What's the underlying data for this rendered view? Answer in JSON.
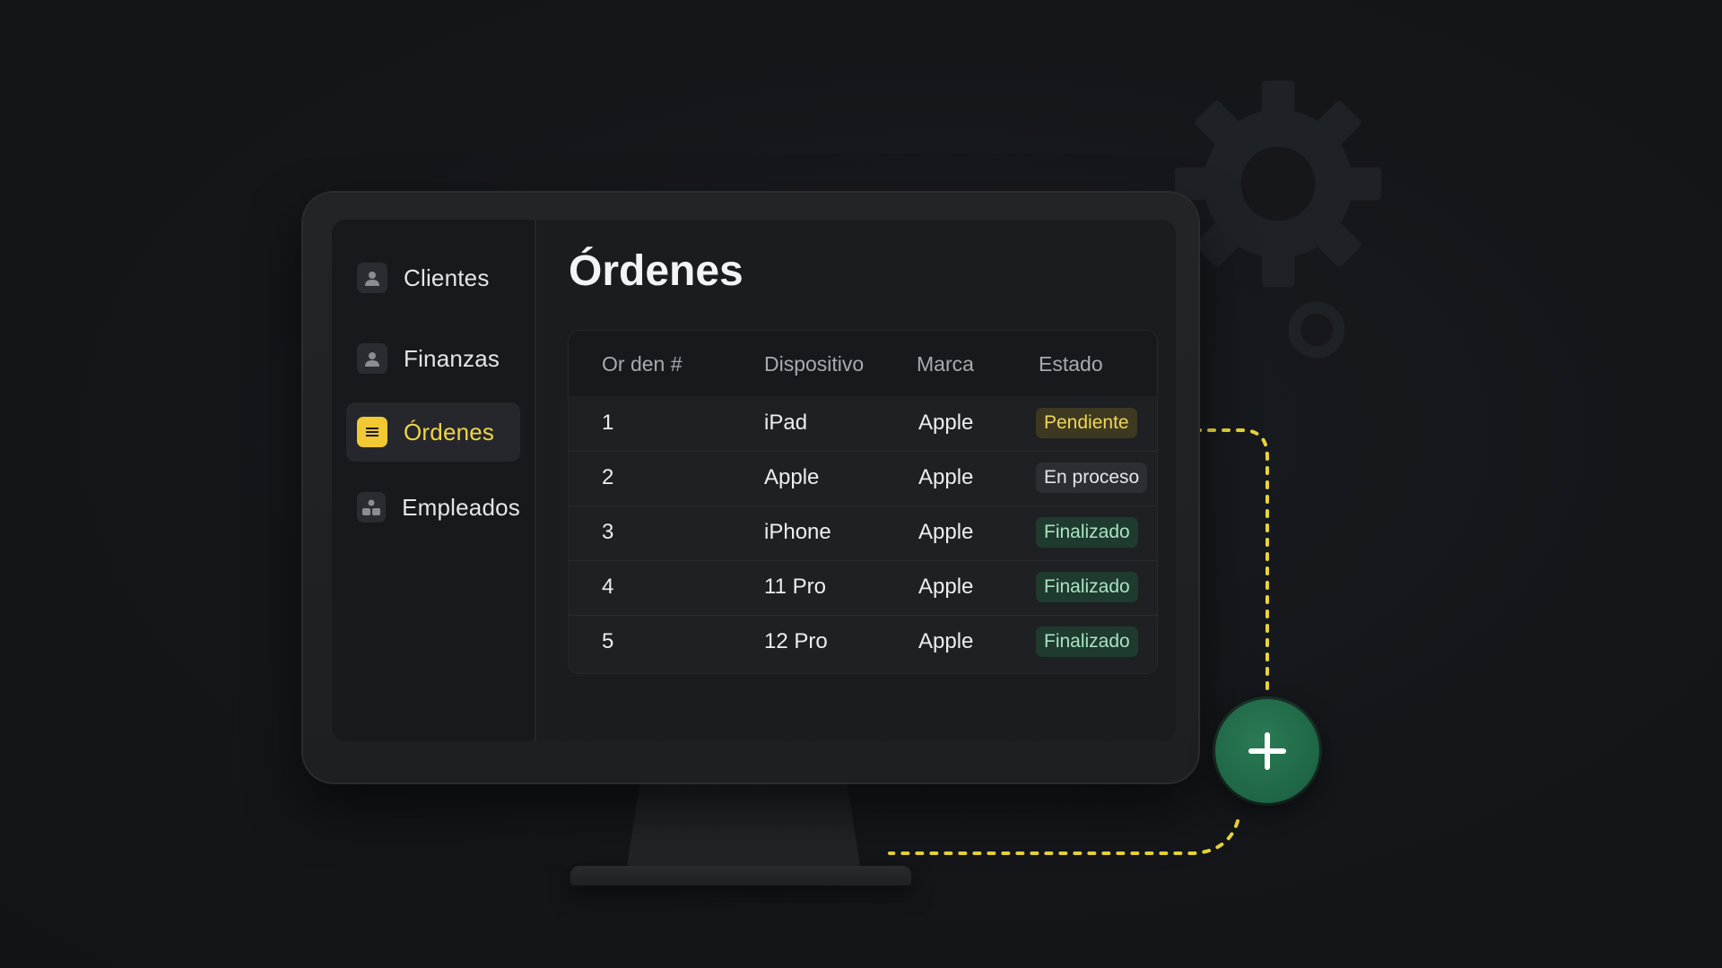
{
  "sidebar": {
    "items": [
      {
        "label": "Clientes",
        "icon": "user-icon"
      },
      {
        "label": "Finanzas",
        "icon": "user-icon"
      },
      {
        "label": "Órdenes",
        "icon": "list-icon",
        "active": true
      },
      {
        "label": "Empleados",
        "icon": "users-icon"
      }
    ]
  },
  "main": {
    "title": "Órdenes",
    "table": {
      "headers": [
        "Or den #",
        "Dispositivo",
        "Marca",
        "Estado"
      ],
      "rows": [
        {
          "num": "1",
          "device": "iPad",
          "brand": "Apple",
          "status": "Pendiente",
          "status_kind": "pending"
        },
        {
          "num": "2",
          "device": "Apple",
          "brand": "Apple",
          "status": "En proceso",
          "status_kind": "progress"
        },
        {
          "num": "3",
          "device": "iPhone",
          "brand": "Apple",
          "status": "Finalizado",
          "status_kind": "done"
        },
        {
          "num": "4",
          "device": "11 Pro",
          "brand": "Apple",
          "status": "Finalizado",
          "status_kind": "done"
        },
        {
          "num": "5",
          "device": "12 Pro",
          "brand": "Apple",
          "status": "Finalizado",
          "status_kind": "done"
        }
      ]
    }
  },
  "fab": {
    "icon": "plus-icon"
  },
  "decorations": {
    "icons": [
      "gear-icon",
      "ring-icon"
    ]
  },
  "colors": {
    "accent_yellow": "#f2c833",
    "fab_green": "#1f6646",
    "pending": "#f1d656",
    "done": "#a9e3c4",
    "connector": "#e8d43a"
  }
}
